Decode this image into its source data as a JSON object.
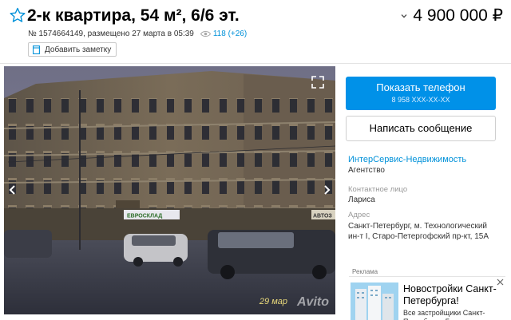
{
  "listing": {
    "title": "2-к квартира, 54 м², 6/6 эт.",
    "price": "4 900 000 ₽",
    "meta": "№ 1574664149, размещено 27 марта в 05:39",
    "views": "118 (+26)",
    "add_note_label": "Добавить заметку"
  },
  "photo": {
    "date_watermark": "29 мар",
    "logo_watermark": "Avito",
    "store_sign": "ЕВРОСКЛАД",
    "auto_sign": "АВТОЗ"
  },
  "contact": {
    "show_phone_label": "Показать телефон",
    "phone_masked": "8 958 XXX-XX-XX",
    "write_message_label": "Написать сообщение",
    "seller_name": "ИнтерСервис-Недвижимость",
    "seller_type": "Агентство",
    "contact_person_label": "Контактное лицо",
    "contact_person": "Лариса",
    "address_label": "Адрес",
    "address": "Санкт-Петербург, м. Технологический ин-т I, Старо-Петергофский пр-кт, 15А"
  },
  "ad": {
    "label": "Реклама",
    "title": "Новостройки Санкт-Петербурга!",
    "description": "Все застройщики Санкт-Петербурга. Бесплатно"
  },
  "colors": {
    "accent": "#0091e8",
    "link": "#0091d9",
    "star": "#0091d9"
  },
  "icons": [
    "star-icon",
    "chevron-down-icon",
    "eye-icon",
    "note-icon",
    "expand-icon",
    "arrow-left-icon",
    "arrow-right-icon",
    "close-icon"
  ]
}
